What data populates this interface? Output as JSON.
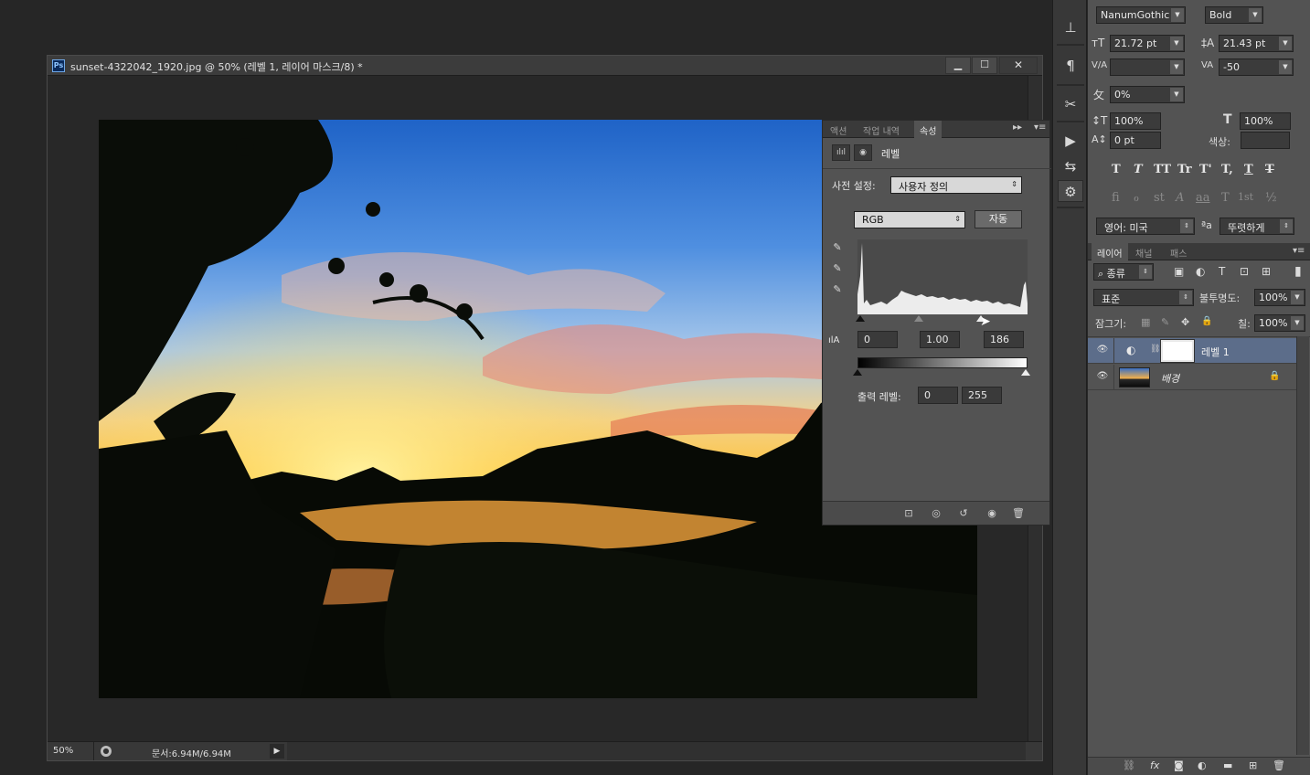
{
  "document": {
    "ps_badge": "Ps",
    "title": "sunset-4322042_1920.jpg @ 50% (레벨 1, 레이어 마스크/8) *",
    "win_min": "▁",
    "win_max": "☐",
    "win_close": "✕",
    "status_zoom": "50%",
    "status_doc": "문서:6.94M/6.94M",
    "status_arrow": "▶"
  },
  "properties": {
    "tabs": [
      "액션",
      "작업 내역",
      "속성"
    ],
    "active_tab": "속성",
    "menu_collapse": "▸▸",
    "menu": "▾≡",
    "icon_levels": "ılıl",
    "icon_mask": "◉",
    "title": "레벨",
    "preset_label": "사전 설정:",
    "preset_value": "사용자 정의",
    "channel_value": "RGB",
    "auto_button": "자동",
    "input_icon": "ılA",
    "input_black": "0",
    "input_gamma": "1.00",
    "input_white": "186",
    "output_label": "출력 레벨:",
    "output_black": "0",
    "output_white": "255",
    "eyedropper": "✎",
    "footer_icons": [
      "⊡",
      "◎",
      "↺",
      "◉",
      "🗑"
    ]
  },
  "icon_strip": {
    "icons": [
      "⊥",
      "¶",
      "✂",
      "▶",
      "⇆",
      "⚙"
    ]
  },
  "character": {
    "font_family": "NanumGothic",
    "font_style": "Bold",
    "size_icon": "тT",
    "font_size": "21.72 pt",
    "leading_icon": "‡A",
    "leading": "21.43 pt",
    "kerning_icon": "V/A",
    "kerning": "",
    "tracking_icon": "VA",
    "tracking": "-50",
    "tsume_icon": "攵",
    "tsume": "0%",
    "vscale_icon": "↕T",
    "vertical_scale": "100%",
    "hscale_icon": "T",
    "horizontal_scale": "100%",
    "baseline_icon": "A↕",
    "baseline": "0 pt",
    "color_label": "색상:",
    "style_buttons": [
      "T",
      "T",
      "TT",
      "Tr",
      "T'",
      "T,",
      "T",
      "T"
    ],
    "opentype_buttons": [
      "fi",
      "ℴ",
      "st",
      "A",
      "aa",
      "T",
      "1st",
      "½"
    ],
    "language": "영어: 미국",
    "aa_icon": "ªa",
    "antialias": "뚜렷하게"
  },
  "layers_panel": {
    "tabs": [
      "레이어",
      "채널",
      "패스"
    ],
    "active_tab": "레이어",
    "menu": "▾≡",
    "kind_filter": "⌕ 종류",
    "filter_icons": [
      "▣",
      "◐",
      "T",
      "⊡",
      "⊞"
    ],
    "filter_toggle": "▮",
    "blend_mode": "표준",
    "opacity_label": "불투명도:",
    "opacity": "100%",
    "lock_label": "잠그기:",
    "lock_icons": [
      "▦",
      "✎",
      "✥",
      "🔒"
    ],
    "fill_label": "칠:",
    "fill": "100%",
    "layers": [
      {
        "name": "레벨 1",
        "visible": "👁",
        "adj_icon": "◐",
        "link": "⛓",
        "selected": true
      },
      {
        "name": "배경",
        "visible": "👁",
        "lock": "🔒",
        "selected": false
      }
    ],
    "footer_icons": [
      "⛓",
      "fx",
      "◙",
      "◐",
      "▬",
      "⊞",
      "🗑"
    ]
  }
}
